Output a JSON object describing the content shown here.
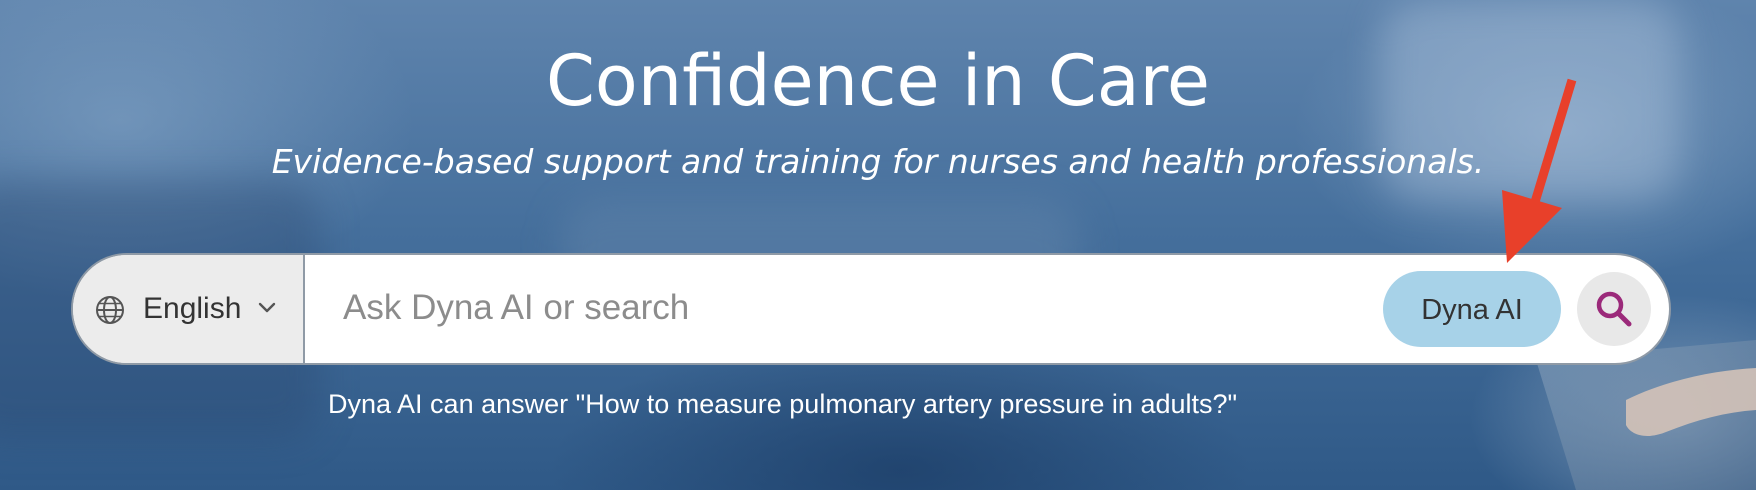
{
  "hero": {
    "title": "Confidence in Care",
    "subtitle": "Evidence-based support and training for nurses and health professionals."
  },
  "search": {
    "language": {
      "icon": "globe-icon",
      "label": "English",
      "chevron_icon": "chevron-down-icon"
    },
    "placeholder": "Ask Dyna AI or search",
    "value": "",
    "dyna_button_label": "Dyna AI",
    "search_icon": "search-icon",
    "hint": "Dyna AI can answer \"How to measure pulmonary artery pressure in adults?\""
  },
  "annotation": {
    "arrow_icon": "red-arrow-icon",
    "arrow_color": "#e8402a"
  },
  "colors": {
    "accent_button": "#a7d2e8",
    "search_icon": "#9b2a7a",
    "background": "#46709d"
  }
}
